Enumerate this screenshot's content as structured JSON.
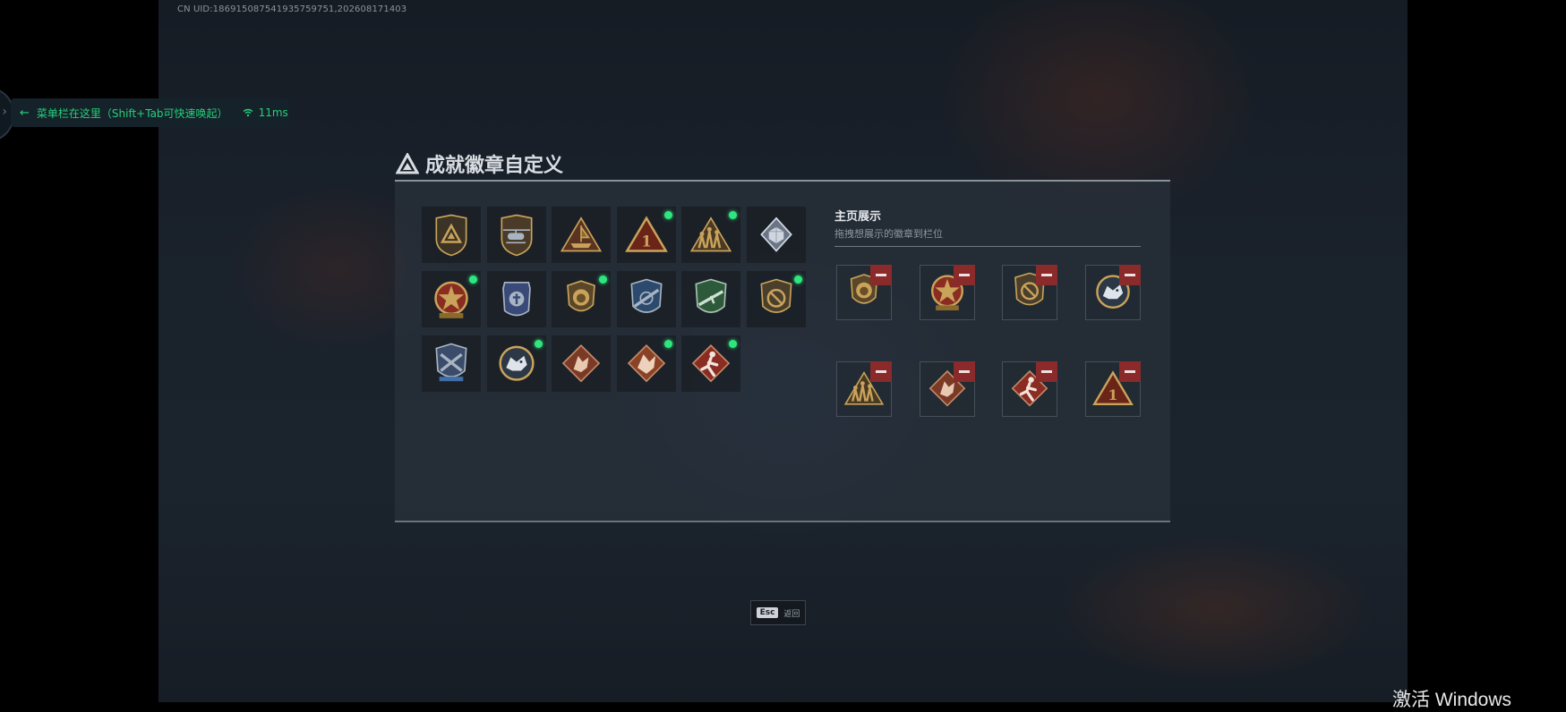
{
  "uid_text": "CN UID:186915087541935759751,202608171403",
  "menu_hint": {
    "text": "菜单栏在这里（Shift+Tab可快速唤起）",
    "ping": "11ms",
    "accent": "#25d07a"
  },
  "dialog": {
    "title": "成就徽章自定义",
    "badges": [
      {
        "icon": "triangle-shield-badge-icon",
        "new": false
      },
      {
        "icon": "helicopter-badge-icon",
        "new": false
      },
      {
        "icon": "ship-triangle-badge-icon",
        "new": false
      },
      {
        "icon": "number-one-triangle-badge-icon",
        "new": true
      },
      {
        "icon": "soldiers-triangle-badge-icon",
        "new": true
      },
      {
        "icon": "crystal-cube-badge-icon",
        "new": false
      },
      {
        "icon": "star-medal-badge-icon",
        "new": true
      },
      {
        "icon": "police-badge-icon",
        "new": false
      },
      {
        "icon": "lion-shield-badge-icon",
        "new": true
      },
      {
        "icon": "rifle-blue-shield-badge-icon",
        "new": false
      },
      {
        "icon": "rifle-green-shield-badge-icon",
        "new": false
      },
      {
        "icon": "no-sign-shield-badge-icon",
        "new": true
      },
      {
        "icon": "crossed-guns-shield-badge-icon",
        "new": false
      },
      {
        "icon": "wolf-round-badge-icon",
        "new": true
      },
      {
        "icon": "dragon-diamond-badge-icon",
        "new": false
      },
      {
        "icon": "dragon-diamond-badge-2-icon",
        "new": true
      },
      {
        "icon": "runner-diamond-badge-icon",
        "new": true
      }
    ],
    "showcase": {
      "title": "主页展示",
      "subtitle": "拖拽想展示的徽章到栏位",
      "slots": [
        {
          "icon": "lion-shield-badge-icon"
        },
        {
          "icon": "star-medal-badge-icon"
        },
        {
          "icon": "no-sign-shield-badge-icon"
        },
        {
          "icon": "wolf-round-badge-icon"
        },
        {
          "icon": "soldiers-triangle-badge-icon"
        },
        {
          "icon": "dragon-diamond-badge-icon"
        },
        {
          "icon": "runner-diamond-badge-icon"
        },
        {
          "icon": "number-one-triangle-badge-icon"
        }
      ]
    },
    "new_dot_color": "#2ee67e",
    "remove_color": "#8a2a2a"
  },
  "footer": {
    "esc_key": "Esc",
    "esc_label": "返回"
  },
  "windows_watermark": "激活 Windows"
}
